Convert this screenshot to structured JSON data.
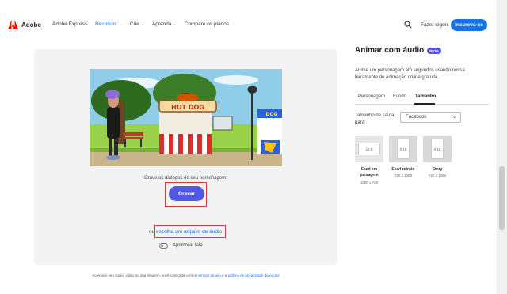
{
  "header": {
    "brand": "Adobe",
    "nav": [
      {
        "label": "Adobe Express",
        "has_chevron": false,
        "active": false
      },
      {
        "label": "Recursos",
        "has_chevron": true,
        "active": true
      },
      {
        "label": "Crie",
        "has_chevron": true,
        "active": false
      },
      {
        "label": "Aprenda",
        "has_chevron": true,
        "active": false
      },
      {
        "label": "Compare os planos",
        "has_chevron": false,
        "active": false
      }
    ],
    "login_label": "Fazer logon",
    "signup_label": "Inscreva-se",
    "brand_color": "#eb1000",
    "accent_color": "#1473e6"
  },
  "canvas": {
    "scene_text": {
      "stand_sign": "HOT DOG",
      "right_sign": "DOG"
    },
    "instruction": "Grave os diálogos do seu personagem:",
    "record_label": "Gravar",
    "or_text": "ou",
    "upload_link": "escolha um arquivo de áudio",
    "enhance_label": "Aprimorar fala",
    "consent_prefix": "Ao enviar seu áudio, vídeo ou sua imagem, você concorda com os",
    "terms_link": "termos de uso",
    "consent_mid": "e a",
    "privacy_link": "política de privacidade da Adobe",
    "record_color": "#5258e4"
  },
  "panel": {
    "title": "Animar com áudio",
    "badge": "BETA",
    "description": "Anime um personagem em segundos usando nossa ferramenta de animação online gratuita.",
    "tabs": [
      "Personagem",
      "Fundo",
      "Tamanho"
    ],
    "active_tab": "Tamanho",
    "size_label": "Tamanho de saída para:",
    "size_select": "Facebook",
    "formats": [
      {
        "ratio": "16:9",
        "name": "Feed em paisagem",
        "dims": "1280 x 720",
        "selected": true
      },
      {
        "ratio": "9:16",
        "name": "Feed retrato",
        "dims": "720 x 1280",
        "selected": false
      },
      {
        "ratio": "9:16",
        "name": "Story",
        "dims": "720 x 1280",
        "selected": false
      }
    ]
  }
}
